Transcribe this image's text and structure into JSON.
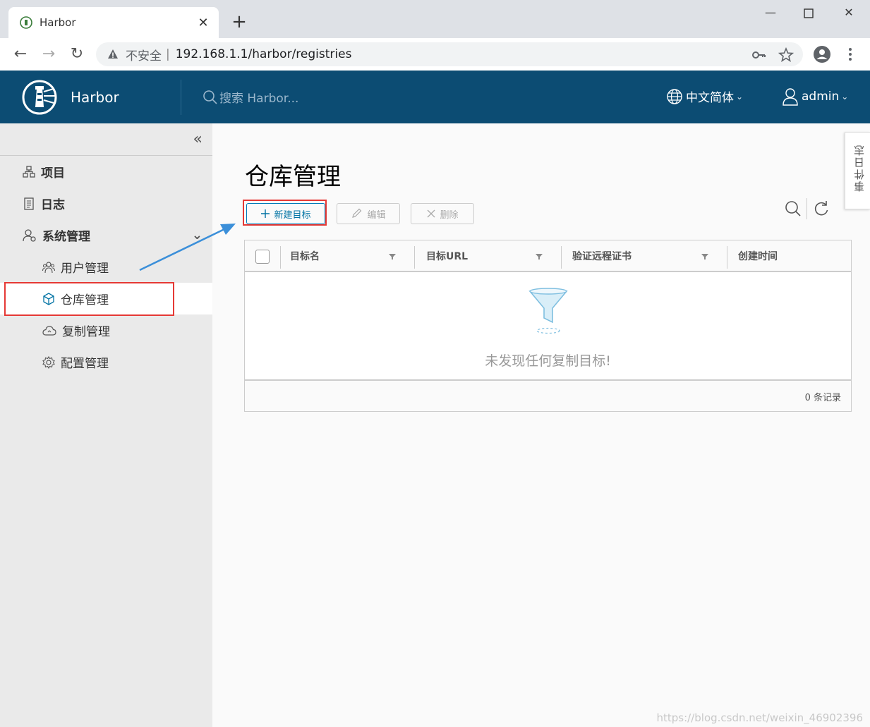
{
  "browser": {
    "tab_title": "Harbor",
    "insecure_label": "不安全",
    "url": "192.168.1.1/harbor/registries"
  },
  "header": {
    "brand": "Harbor",
    "search_placeholder": "搜索 Harbor...",
    "language": "中文简体",
    "user": "admin",
    "background_color": "#0c4c73"
  },
  "sidebar": {
    "items": [
      {
        "label": "项目",
        "icon": "projects-icon"
      },
      {
        "label": "日志",
        "icon": "logs-icon"
      },
      {
        "label": "系统管理",
        "icon": "admin-icon"
      }
    ],
    "sub_items": [
      {
        "label": "用户管理",
        "icon": "users-icon"
      },
      {
        "label": "仓库管理",
        "icon": "registry-icon",
        "active": true
      },
      {
        "label": "复制管理",
        "icon": "replication-icon"
      },
      {
        "label": "配置管理",
        "icon": "config-icon"
      }
    ]
  },
  "main": {
    "title": "仓库管理",
    "buttons": {
      "new": "新建目标",
      "edit": "编辑",
      "delete": "删除"
    },
    "events_tab": "事件日志",
    "table": {
      "columns": [
        "目标名",
        "目标URL",
        "验证远程证书",
        "创建时间"
      ],
      "empty_text": "未发现任何复制目标!",
      "footer": "0 条记录"
    }
  },
  "watermark": "https://blog.csdn.net/weixin_46902396",
  "colors": {
    "accent": "#0072a3",
    "highlight": "#e53935",
    "arrow": "#3b8fd9"
  }
}
